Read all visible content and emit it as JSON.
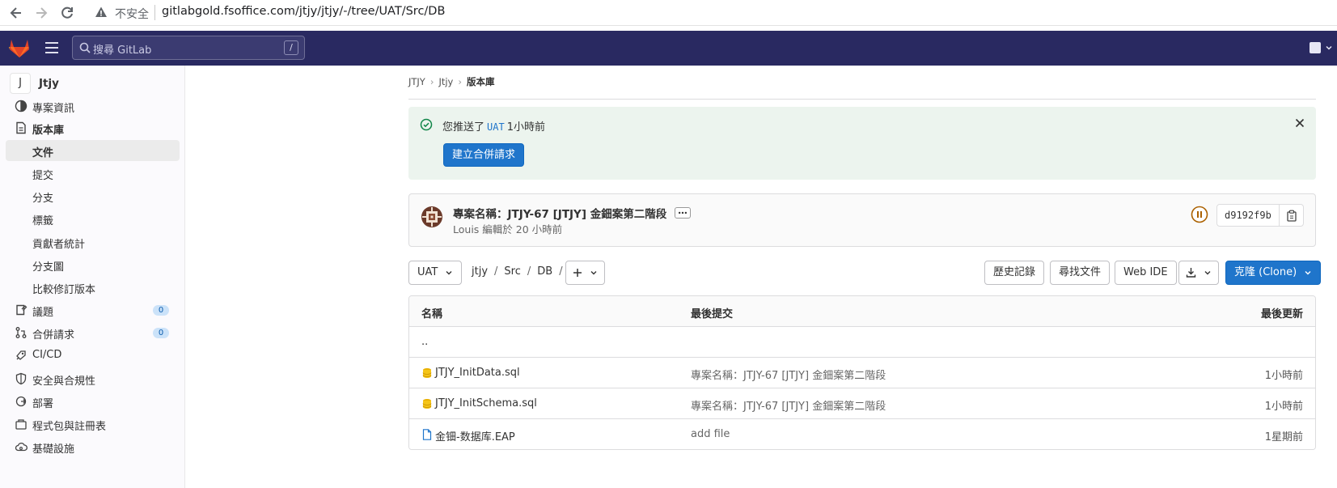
{
  "browser": {
    "insecure_label": "不安全",
    "url": "gitlabgold.fsoffice.com/jtjy/jtjy/-/tree/UAT/Src/DB"
  },
  "topnav": {
    "search_placeholder": "搜尋 GitLab",
    "search_shortcut": "/"
  },
  "sidebar": {
    "project_initial": "J",
    "project_name": "Jtjy",
    "items": [
      {
        "label": "專案資訊",
        "icon": "info-icon"
      },
      {
        "label": "版本庫",
        "icon": "doc-icon"
      },
      {
        "label": "文件",
        "sub": true,
        "active": true
      },
      {
        "label": "提交",
        "sub": true
      },
      {
        "label": "分支",
        "sub": true
      },
      {
        "label": "標籤",
        "sub": true
      },
      {
        "label": "貢獻者統計",
        "sub": true
      },
      {
        "label": "分支圖",
        "sub": true
      },
      {
        "label": "比較修訂版本",
        "sub": true
      },
      {
        "label": "議題",
        "icon": "issues-icon",
        "badge": "0"
      },
      {
        "label": "合併請求",
        "icon": "merge-request-icon",
        "badge": "0"
      },
      {
        "label": "CI/CD",
        "icon": "rocket-icon"
      },
      {
        "label": "安全與合規性",
        "icon": "shield-icon"
      },
      {
        "label": "部署",
        "icon": "deployments-icon"
      },
      {
        "label": "程式包與註冊表",
        "icon": "package-icon"
      },
      {
        "label": "基礎設施",
        "icon": "cloud-icon"
      }
    ]
  },
  "breadcrumb": {
    "items": [
      "JTJY",
      "Jtjy",
      "版本庫"
    ]
  },
  "alert": {
    "prefix": "您推送了",
    "branch": "UAT",
    "suffix": "1小時前",
    "button": "建立合併請求"
  },
  "commit": {
    "title": "專案名稱：JTJY-67 [JTJY] 金鈿案第二階段",
    "author": "Louis",
    "meta": "編輯於 20 小時前",
    "sha": "d9192f9b",
    "pipeline_status": "paused"
  },
  "toolbar": {
    "branch": "UAT",
    "path": [
      "jtjy",
      "Src",
      "DB"
    ],
    "history": "歷史記錄",
    "find_file": "尋找文件",
    "web_ide": "Web IDE",
    "clone": "克隆 (Clone)"
  },
  "files": {
    "headers": {
      "name": "名稱",
      "last_commit": "最後提交",
      "last_update": "最後更新"
    },
    "parent": "..",
    "rows": [
      {
        "name": "JTJY_InitData.sql",
        "icon": "database-icon",
        "commit": "專案名稱：JTJY-67 [JTJY] 金鈿案第二階段",
        "updated": "1小時前"
      },
      {
        "name": "JTJY_InitSchema.sql",
        "icon": "database-icon",
        "commit": "專案名稱：JTJY-67 [JTJY] 金鈿案第二階段",
        "updated": "1小時前"
      },
      {
        "name": "金钿-数据库.EAP",
        "icon": "file-icon",
        "commit": "add file",
        "updated": "1星期前"
      }
    ]
  },
  "colors": {
    "navbar": "#292961",
    "primary": "#1f75cb",
    "alert_bg": "#ecf4ee",
    "success": "#108548",
    "pipeline_paused": "#ab6100"
  }
}
